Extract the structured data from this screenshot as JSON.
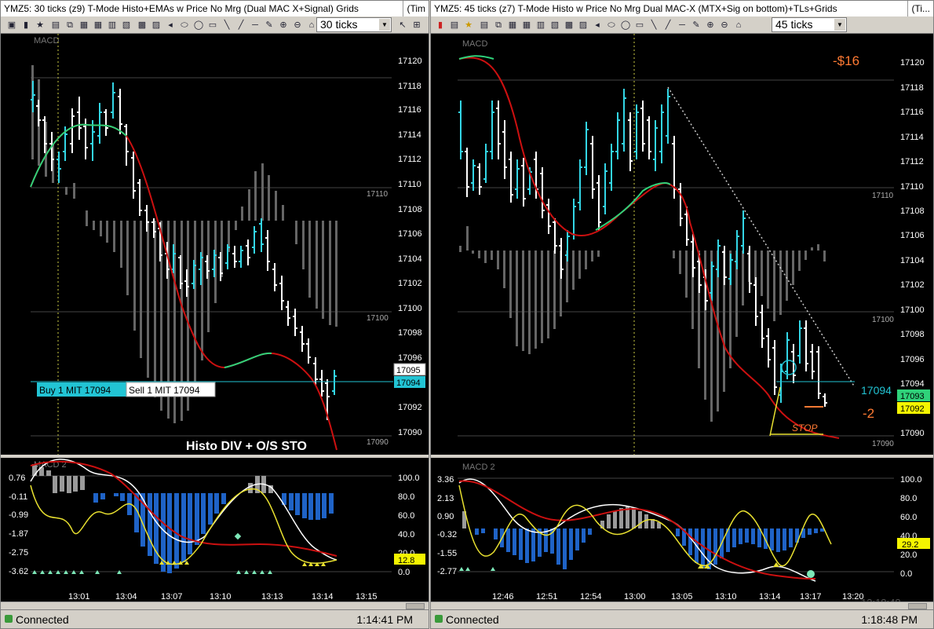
{
  "left": {
    "title": "YMZ5: 30 ticks (z9) T-Mode Histo+EMAs w Price No Mrg (Dual MAC X+Signal) Grids",
    "title_btn": "(Tim",
    "ticks": "30 ticks",
    "panel_label": "MACD",
    "osc_label": "MACD 2",
    "price_axis": [
      "17120",
      "17118",
      "17116",
      "17114",
      "17112",
      "17110",
      "17108",
      "17106",
      "17104",
      "17102",
      "17100",
      "17098",
      "17096",
      "17092",
      "17090"
    ],
    "grid_labels": [
      "17110",
      "17100",
      "17090"
    ],
    "price_tag_white": "17095",
    "price_tag_cyan": "17094",
    "buy_order": "Buy 1 MIT 17094",
    "sell_order": "Sell 1 MIT 17094",
    "annotation": "Histo DIV + O/S STO",
    "osc_left_axis": [
      "0.76",
      "-0.11",
      "-0.99",
      "-1.87",
      "-2.75",
      "-3.62"
    ],
    "osc_right_axis": [
      "100.0",
      "80.0",
      "60.0",
      "40.0",
      "20.0",
      "0.0"
    ],
    "osc_value_tag": "12.8",
    "time_axis": [
      "13:01",
      "13:04",
      "13:07",
      "13:10",
      "13:13",
      "13:14",
      "13:15"
    ],
    "status": "Connected",
    "time": "1:14:41 PM"
  },
  "right": {
    "title": "YMZ5: 45 ticks (z7) T-Mode Histo w Price No Mrg Dual MAC-X (MTX+Sig on bottom)+TLs+Grids",
    "title_btn": "(Ti...",
    "ticks": "45 ticks",
    "panel_label": "MACD",
    "osc_label": "MACD 2",
    "price_axis": [
      "17120",
      "17118",
      "17116",
      "17114",
      "17112",
      "17110",
      "17108",
      "17106",
      "17104",
      "17102",
      "17100",
      "17098",
      "17096",
      "17094",
      "17090"
    ],
    "grid_labels": [
      "17110",
      "17100",
      "17090"
    ],
    "pnl_top": "-$16",
    "price_line_label": "17094",
    "price_tag_green": "17093",
    "price_tag_yellow": "17092",
    "pnl_bottom": "-2",
    "stop_label": "STOP",
    "osc_left_axis": [
      "3.36",
      "2.13",
      "0.90",
      "-0.32",
      "-1.55",
      "-2.77"
    ],
    "osc_right_axis": [
      "100.0",
      "80.0",
      "60.0",
      "40.0",
      "20.0",
      "0.0"
    ],
    "osc_value_tag": "29.2",
    "time_axis": [
      "12:46",
      "12:51",
      "12:54",
      "13:00",
      "13:05",
      "13:10",
      "13:14",
      "13:17",
      "13:20"
    ],
    "status": "Connected",
    "time": "1:18:48 PM",
    "clock_overlay": "13:18:48"
  },
  "colors": {
    "bg": "#000000",
    "bar_up": "#33d6e6",
    "bar_down": "#ffffff",
    "histo": "#6e6e6e",
    "ema_fast": "#2fd27a",
    "ema_slow": "#cc1010",
    "cyan_line": "#22c4d4",
    "orange": "#ff7a33",
    "blue_histo": "#1f63c7",
    "stoch": "#e8e030",
    "signal_dots": "#7de8b8"
  }
}
